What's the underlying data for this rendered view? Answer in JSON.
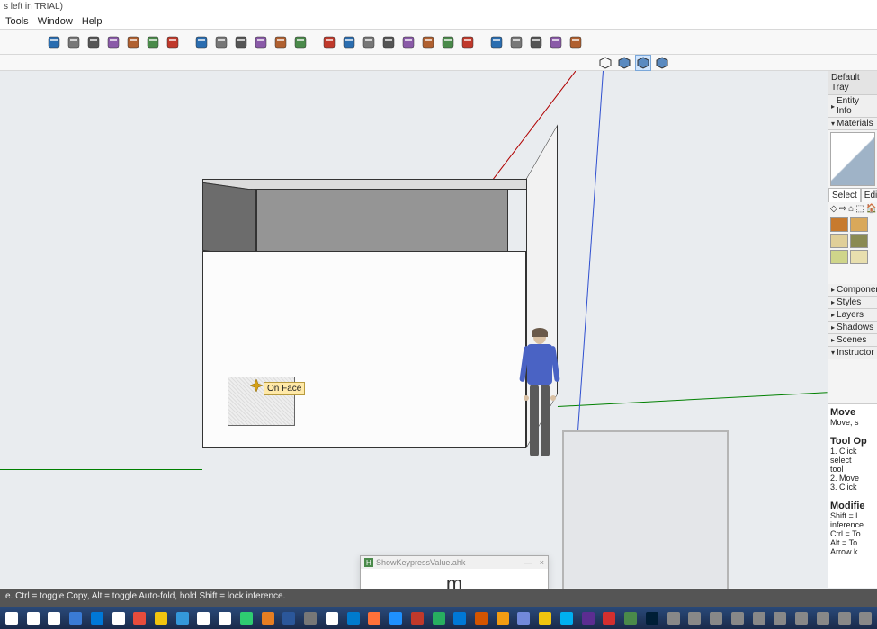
{
  "title_suffix": "s left in TRIAL)",
  "menu": {
    "tools": "Tools",
    "window": "Window",
    "help": "Help"
  },
  "toolbar_icons": [
    "book-blue",
    "book-outline",
    "book-plain",
    "pages",
    "pages-purple",
    "rect-pattern",
    "rect-iso",
    "building-blue",
    "building-grey",
    "house",
    "box-open",
    "house-outline",
    "box-orange",
    "book-red",
    "book-open",
    "grid",
    "crosshatch",
    "crosshatch2",
    "crosshatch3",
    "book-dark",
    "leaf",
    "globe-blue",
    "globe-grey",
    "globe-brown",
    "globe-dark",
    "globe-teal"
  ],
  "toolbar2": {
    "items": [
      "axis-lock",
      "cube-wire",
      "cube-solid",
      "cube-xray"
    ],
    "selected": 2
  },
  "inference_tip": "On Face",
  "tray": {
    "title": "Default Tray",
    "panels": [
      "Entity Info",
      "Materials",
      "Components",
      "Styles",
      "Layers",
      "Shadows",
      "Scenes",
      "Instructor"
    ],
    "materials": {
      "tabs": {
        "select": "Select",
        "edit": "Edit"
      },
      "tool_glyphs": [
        "◇",
        "⇨",
        "⌂",
        "⬚",
        "🏠"
      ],
      "swatches": [
        "#c77a2e",
        "#d9a85a",
        "#e0cf99",
        "#8a8a52",
        "#cfd58a",
        "#e8dfae"
      ]
    }
  },
  "instructor": {
    "heading": "Move",
    "sub": "Move, s",
    "tool_op_h": "Tool Op",
    "op1": "1. Click",
    "op1b": "select",
    "op1c": "tool",
    "op2": "2. Move",
    "op3": "3. Click",
    "mod_h": "Modifie",
    "mod1": "Shift = l",
    "mod1b": "inference",
    "mod2": "Ctrl = To",
    "mod3": "Alt = To",
    "mod4": "Arrow k"
  },
  "keypop": {
    "title": "ShowKeypressValue.ahk",
    "close": "×",
    "min": "—",
    "key": "m"
  },
  "statusbar": "e.  Ctrl = toggle Copy, Alt = toggle Auto-fold, hold Shift = lock inference.",
  "taskbar_icons": [
    "win",
    "search",
    "task",
    "mail",
    "edge",
    "store",
    "candy",
    "explorer",
    "shield",
    "calc",
    "keyboard",
    "def",
    "chrome",
    "word",
    "dash",
    "snip",
    "code",
    "firefox",
    "ie",
    "audio",
    "antiv",
    "onedrive",
    "oo",
    "keep",
    "discord",
    "notes",
    "skype",
    "vs",
    "sketchup",
    "ahk",
    "ps",
    "misc",
    "misc2",
    "misc3",
    "misc4",
    "tray1",
    "tray2",
    "tray3",
    "tray4",
    "tray5",
    "tray6"
  ]
}
